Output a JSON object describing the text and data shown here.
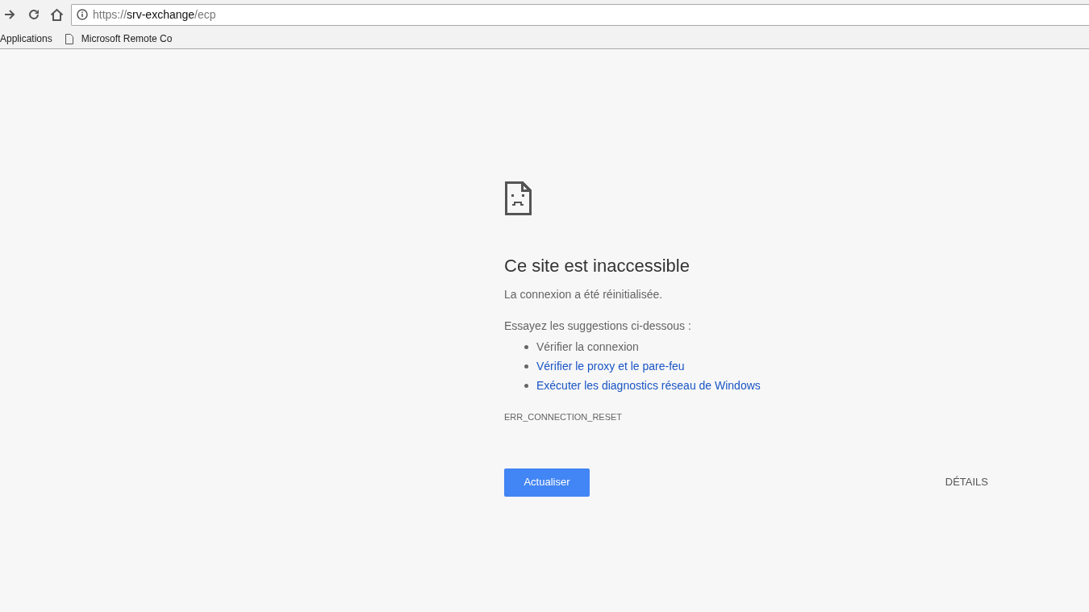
{
  "address_bar": {
    "url_parts": [
      {
        "kind": "dim",
        "text": "https://"
      },
      {
        "kind": "host",
        "text": "srv-exchange"
      },
      {
        "kind": "dim",
        "text": "/ecp"
      }
    ]
  },
  "bookmarks": [
    {
      "kind": "apps",
      "label": "Applications"
    },
    {
      "kind": "page",
      "label": "Microsoft Remote Co"
    }
  ],
  "error": {
    "title": "Ce site est inaccessible",
    "message": "La connexion a été réinitialisée.",
    "suggestions_intro": "Essayez les suggestions ci-dessous :",
    "suggestions": [
      {
        "kind": "text",
        "label": "Vérifier la connexion"
      },
      {
        "kind": "link",
        "label": "Vérifier le proxy et le pare-feu"
      },
      {
        "kind": "link",
        "label": "Exécuter les diagnostics réseau de Windows"
      }
    ],
    "code": "ERR_CONNECTION_RESET",
    "reload_button": "Actualiser",
    "details_button": "DÉTAILS"
  }
}
